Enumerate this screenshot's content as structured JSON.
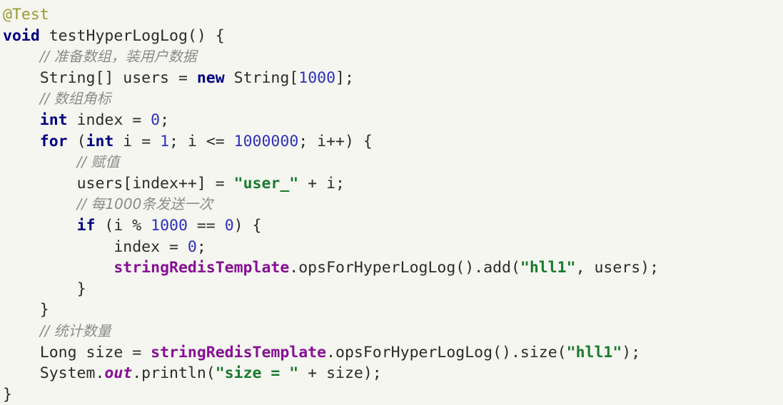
{
  "editor": {
    "language": "java",
    "background_color": "#f5f6f0",
    "default_text_color": "#2b2b2b",
    "palette": {
      "annotation": "#9a9a2e",
      "keyword": "#000080",
      "number": "#2d30b8",
      "string": "#1a7a2e",
      "comment": "#8c8c8c",
      "field": "#871094",
      "static_field": "#871094"
    }
  },
  "lines": [
    {
      "indent": 0,
      "tokens": [
        {
          "t": "@Test",
          "k": "annotation"
        }
      ]
    },
    {
      "indent": 0,
      "tokens": [
        {
          "t": "void",
          "k": "keyword"
        },
        {
          "t": " testHyperLogLog() {",
          "k": "plain"
        }
      ]
    },
    {
      "indent": 1,
      "tokens": [
        {
          "t": "// 准备数组，装用户数据",
          "k": "comment"
        }
      ]
    },
    {
      "indent": 1,
      "tokens": [
        {
          "t": "String[] users = ",
          "k": "plain"
        },
        {
          "t": "new",
          "k": "keyword"
        },
        {
          "t": " String[",
          "k": "plain"
        },
        {
          "t": "1000",
          "k": "number"
        },
        {
          "t": "];",
          "k": "plain"
        }
      ]
    },
    {
      "indent": 1,
      "tokens": [
        {
          "t": "// 数组角标",
          "k": "comment"
        }
      ]
    },
    {
      "indent": 1,
      "tokens": [
        {
          "t": "int",
          "k": "keyword"
        },
        {
          "t": " index = ",
          "k": "plain"
        },
        {
          "t": "0",
          "k": "number"
        },
        {
          "t": ";",
          "k": "plain"
        }
      ]
    },
    {
      "indent": 1,
      "tokens": [
        {
          "t": "for",
          "k": "keyword"
        },
        {
          "t": " (",
          "k": "plain"
        },
        {
          "t": "int",
          "k": "keyword"
        },
        {
          "t": " i = ",
          "k": "plain"
        },
        {
          "t": "1",
          "k": "number"
        },
        {
          "t": "; i <= ",
          "k": "plain"
        },
        {
          "t": "1000000",
          "k": "number"
        },
        {
          "t": "; i++) {",
          "k": "plain"
        }
      ]
    },
    {
      "indent": 2,
      "tokens": [
        {
          "t": "// 赋值",
          "k": "comment"
        }
      ]
    },
    {
      "indent": 2,
      "tokens": [
        {
          "t": "users[index++] = ",
          "k": "plain"
        },
        {
          "t": "\"user_\"",
          "k": "string"
        },
        {
          "t": " + i;",
          "k": "plain"
        }
      ]
    },
    {
      "indent": 2,
      "tokens": [
        {
          "t": "// 每1000条发送一次",
          "k": "comment"
        }
      ]
    },
    {
      "indent": 2,
      "tokens": [
        {
          "t": "if",
          "k": "keyword"
        },
        {
          "t": " (i % ",
          "k": "plain"
        },
        {
          "t": "1000",
          "k": "number"
        },
        {
          "t": " == ",
          "k": "plain"
        },
        {
          "t": "0",
          "k": "number"
        },
        {
          "t": ") {",
          "k": "plain"
        }
      ]
    },
    {
      "indent": 3,
      "tokens": [
        {
          "t": "index = ",
          "k": "plain"
        },
        {
          "t": "0",
          "k": "number"
        },
        {
          "t": ";",
          "k": "plain"
        }
      ]
    },
    {
      "indent": 3,
      "tokens": [
        {
          "t": "stringRedisTemplate",
          "k": "field"
        },
        {
          "t": ".opsForHyperLogLog().add(",
          "k": "plain"
        },
        {
          "t": "\"hll1\"",
          "k": "string"
        },
        {
          "t": ", users);",
          "k": "plain"
        }
      ]
    },
    {
      "indent": 2,
      "tokens": [
        {
          "t": "}",
          "k": "plain"
        }
      ]
    },
    {
      "indent": 1,
      "tokens": [
        {
          "t": "}",
          "k": "plain"
        }
      ]
    },
    {
      "indent": 1,
      "tokens": [
        {
          "t": "// 统计数量",
          "k": "comment"
        }
      ]
    },
    {
      "indent": 1,
      "tokens": [
        {
          "t": "Long size = ",
          "k": "plain"
        },
        {
          "t": "stringRedisTemplate",
          "k": "field"
        },
        {
          "t": ".opsForHyperLogLog().size(",
          "k": "plain"
        },
        {
          "t": "\"hll1\"",
          "k": "string"
        },
        {
          "t": ");",
          "k": "plain"
        }
      ]
    },
    {
      "indent": 1,
      "tokens": [
        {
          "t": "System.",
          "k": "plain"
        },
        {
          "t": "out",
          "k": "static"
        },
        {
          "t": ".println(",
          "k": "plain"
        },
        {
          "t": "\"size = \"",
          "k": "string"
        },
        {
          "t": " + size);",
          "k": "plain"
        }
      ]
    },
    {
      "indent": 0,
      "tokens": [
        {
          "t": "}",
          "k": "plain"
        }
      ]
    }
  ]
}
